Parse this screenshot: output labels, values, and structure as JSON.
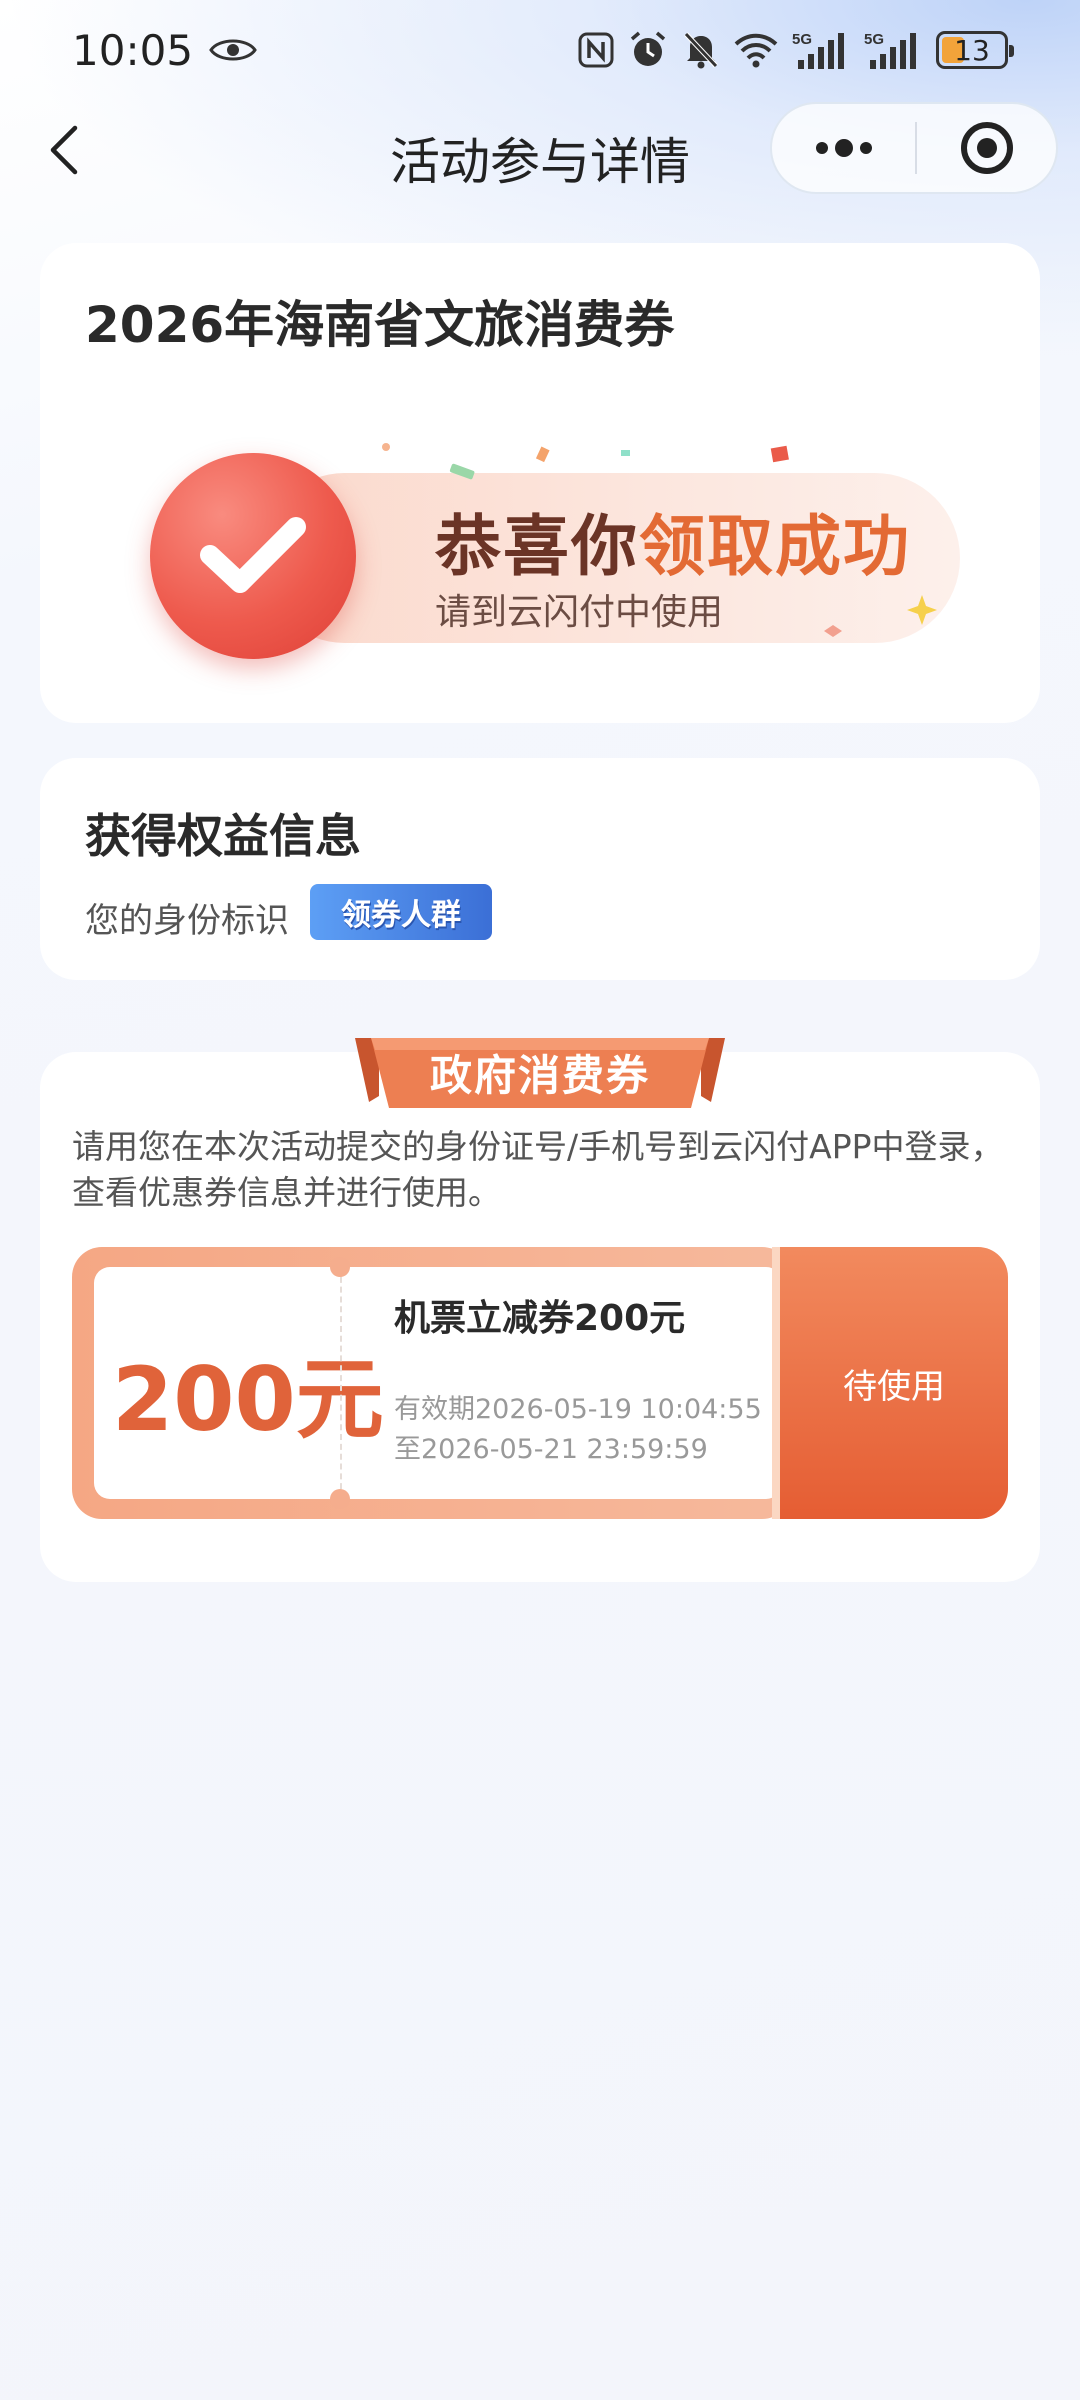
{
  "status_bar": {
    "time": "10:05",
    "battery": "13",
    "icons": [
      "eye-icon",
      "nfc-icon",
      "alarm-icon",
      "mute-icon",
      "wifi-icon",
      "5g-signal-icon",
      "5g-signal-icon",
      "battery-icon"
    ],
    "network_1": "5G",
    "network_2": "5G"
  },
  "nav": {
    "title": "活动参与详情",
    "back_icon": "chevron-left-icon",
    "more_icon": "more-dots-icon",
    "close_icon": "target-close-icon"
  },
  "activity": {
    "title": "2026年海南省文旅消费券",
    "congrats_part1": "恭喜你",
    "congrats_part2": "领取成功",
    "subtitle": "请到云闪付中使用"
  },
  "rights": {
    "title": "获得权益信息",
    "identity_label": "您的身份标识",
    "identity_badge": "领券人群"
  },
  "coupon_section": {
    "ribbon": "政府消费券",
    "notice": "请用您在本次活动提交的身份证号/手机号到云闪付APP中登录，查看优惠券信息并进行使用。",
    "coupon": {
      "amount": "200元",
      "name": "机票立减券200元",
      "valid_from": "有效期2026-05-19 10:04:55",
      "valid_to": "至2026-05-21 23:59:59",
      "status": "待使用"
    }
  },
  "colors": {
    "accent_orange": "#e0633a",
    "success_red": "#ee5a4d",
    "badge_blue": "#3b6fd6"
  }
}
